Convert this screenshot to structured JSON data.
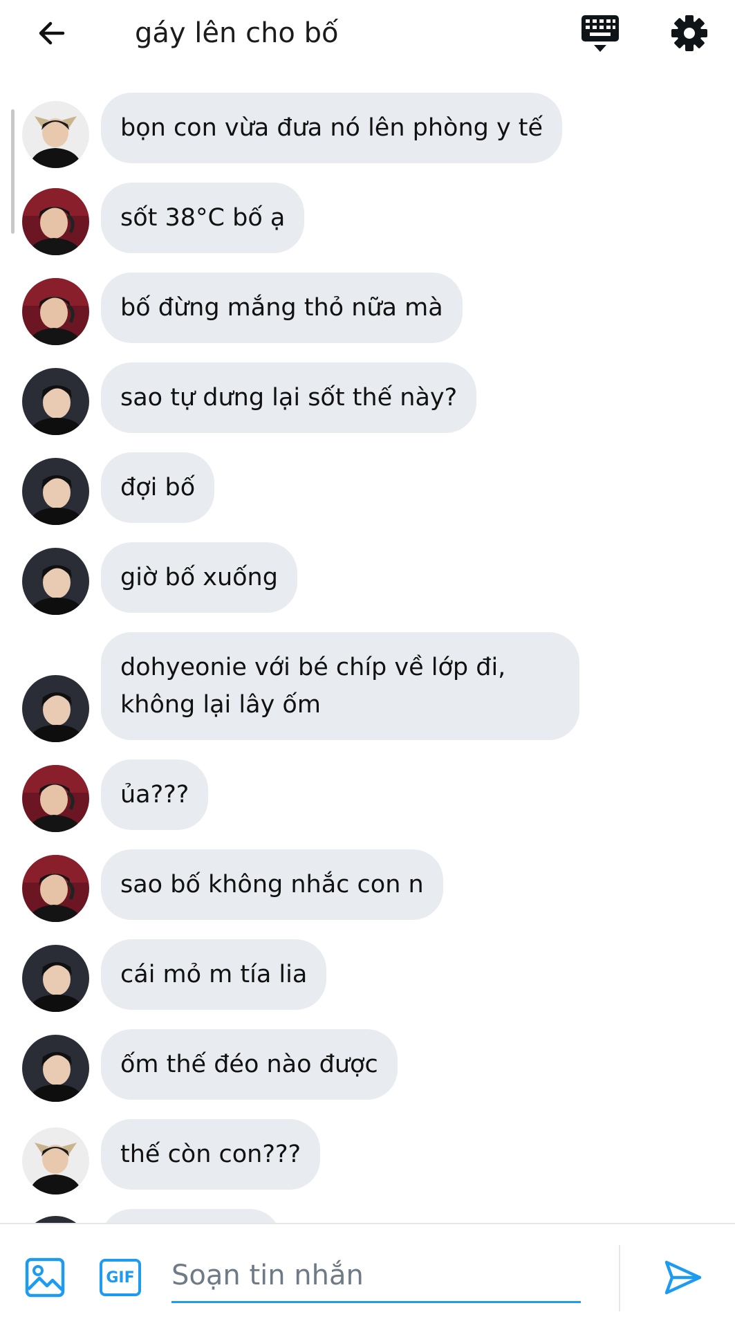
{
  "header": {
    "title": "gáy lên cho bố"
  },
  "messages": [
    {
      "text": "bọn con vừa đưa nó lên phòng y tế",
      "avatar": "avatar-cat-ears"
    },
    {
      "text": "sốt 38°C bố ạ",
      "avatar": "avatar-headset"
    },
    {
      "text": "bố đừng mắng thỏ nữa mà",
      "avatar": "avatar-headset"
    },
    {
      "text": "sao tự dưng lại sốt thế này?",
      "avatar": "avatar-smiling"
    },
    {
      "text": "đợi bố",
      "avatar": "avatar-smiling"
    },
    {
      "text": "giờ bố xuống",
      "avatar": "avatar-smiling"
    },
    {
      "text": "dohyeonie với bé chíp về lớp đi, không lại lây ốm",
      "avatar": "avatar-smiling"
    },
    {
      "text": "ủa???",
      "avatar": "avatar-headset"
    },
    {
      "text": "sao bố không nhắc con n",
      "avatar": "avatar-headset"
    },
    {
      "text": "cái mỏ m tía lia",
      "avatar": "avatar-smiling"
    },
    {
      "text": "ốm thế đéo nào được",
      "avatar": "avatar-smiling"
    },
    {
      "text": "thế còn con???",
      "avatar": "avatar-cat-ears"
    }
  ],
  "composer": {
    "placeholder": "Soạn tin nhắn",
    "gif_label": "GIF"
  },
  "colors": {
    "accent": "#1d9bf0",
    "bubble": "#e8ebf0",
    "text": "#111111"
  }
}
